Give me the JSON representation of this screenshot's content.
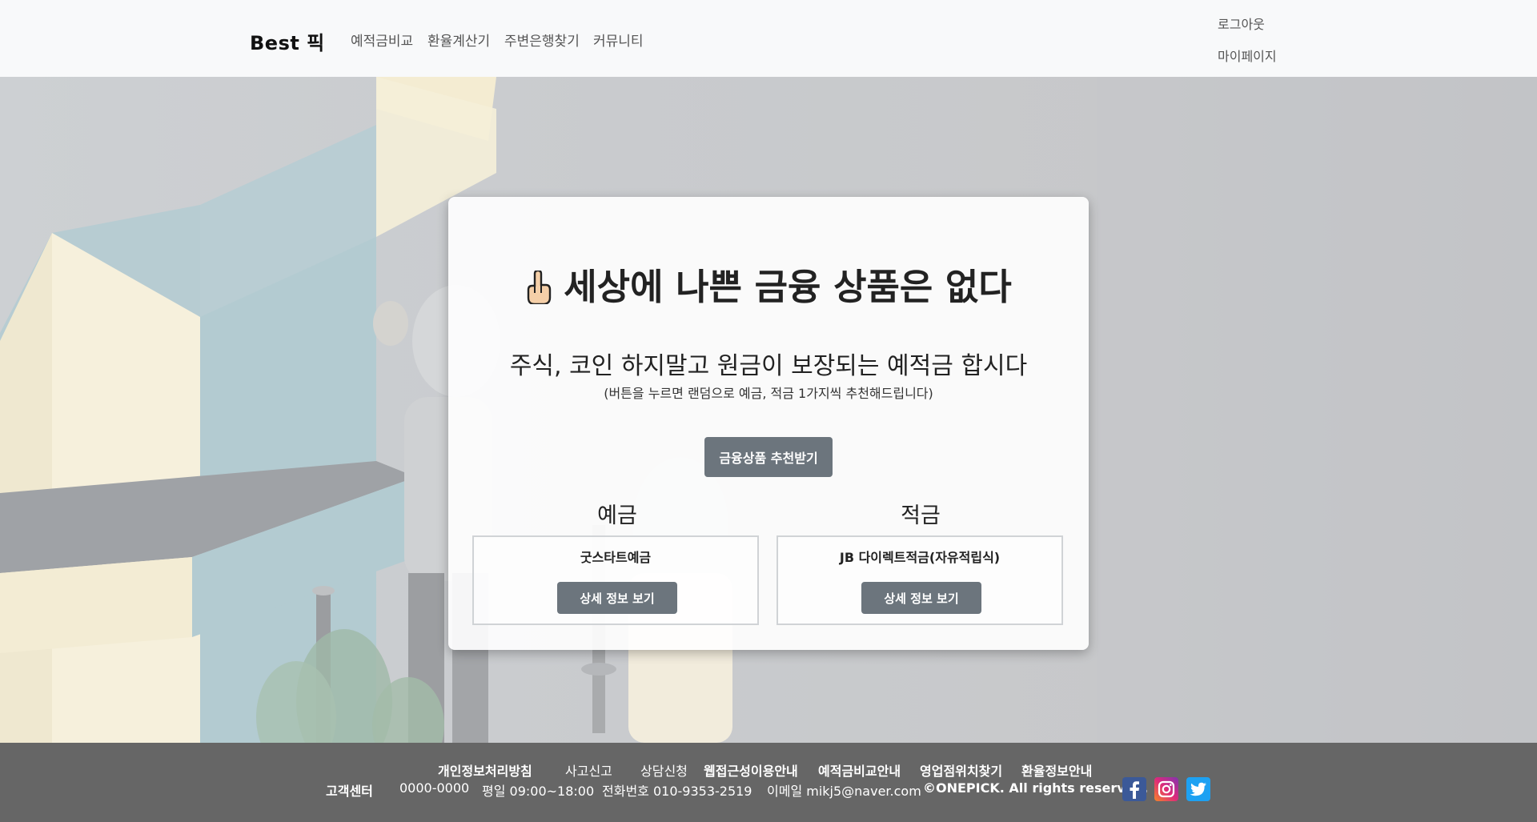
{
  "header": {
    "brand": "Best 픽",
    "nav": [
      "예적금비교",
      "환율계산기",
      "주변은행찾기",
      "커뮤니티"
    ],
    "logout": "로그아웃",
    "mypage": "마이페이지"
  },
  "card": {
    "title_emoji": "☝",
    "title": "세상에 나쁜 금융 상품은 없다",
    "subtitle": "주식, 코인 하지말고 원금이 보장되는 예적금 합시다",
    "note": "(버튼을 누르면 랜덤으로 예금, 적금 1가지씩 추천해드립니다)",
    "recommend_button": "금융상품 추천받기",
    "deposit": {
      "label": "예금",
      "product": "굿스타트예금",
      "button": "상세 정보 보기"
    },
    "savings": {
      "label": "적금",
      "product": "JB 다이렉트적금(자유적립식)",
      "button": "상세 정보 보기"
    }
  },
  "footer": {
    "links": [
      "개인정보처리방침",
      "사고신고",
      "상담신청",
      "웹접근성이용안내",
      "예적금비교안내",
      "영업점위치찾기",
      "환율정보안내"
    ],
    "info": {
      "center_label": "고객센터",
      "center_number": "0000-0000",
      "hours": "평일 09:00~18:00",
      "phone": "전화번호 010-9353-2519",
      "email": "이메일 mikj5@naver.com",
      "copyright": "©ONEPICK. All rights reserved."
    },
    "social": [
      {
        "icon": "facebook-icon",
        "color": "#3b5998"
      },
      {
        "icon": "instagram-icon",
        "color": "#e1306c"
      },
      {
        "icon": "twitter-icon",
        "color": "#1da1f2"
      }
    ]
  }
}
